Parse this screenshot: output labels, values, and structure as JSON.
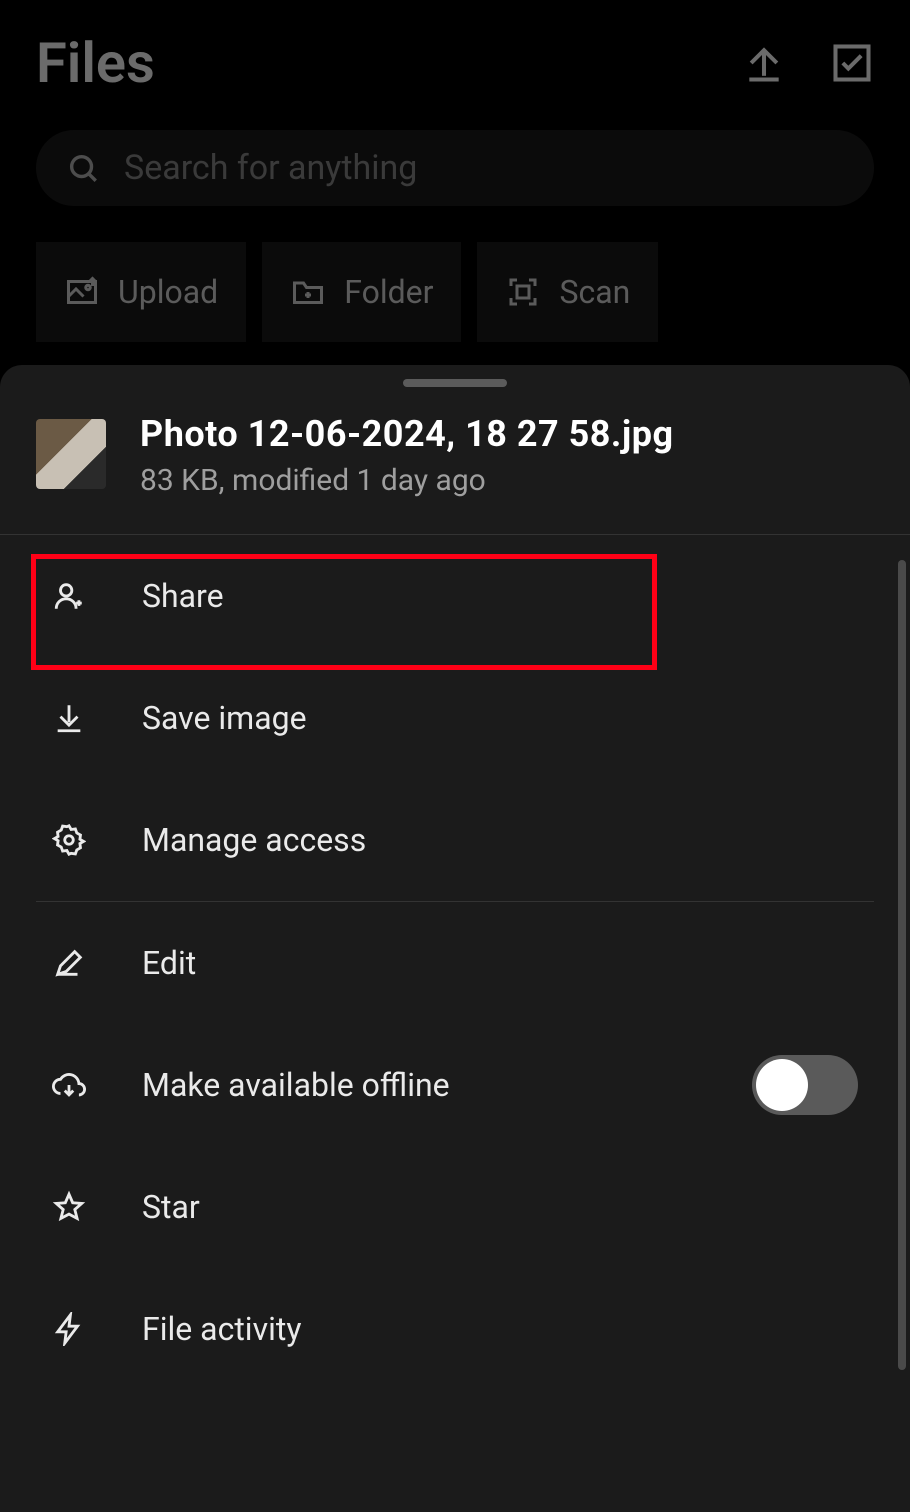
{
  "header": {
    "title": "Files"
  },
  "search": {
    "placeholder": "Search for anything"
  },
  "actions": {
    "upload": "Upload",
    "folder": "Folder",
    "scan": "Scan"
  },
  "file": {
    "name": "Photo 12-06-2024, 18 27 58.jpg",
    "meta": "83 KB, modified 1 day ago"
  },
  "menu": {
    "share": "Share",
    "save_image": "Save image",
    "manage_access": "Manage access",
    "edit": "Edit",
    "make_offline": "Make available offline",
    "offline_toggle": false,
    "star": "Star",
    "file_activity": "File activity"
  },
  "highlighted": "share"
}
